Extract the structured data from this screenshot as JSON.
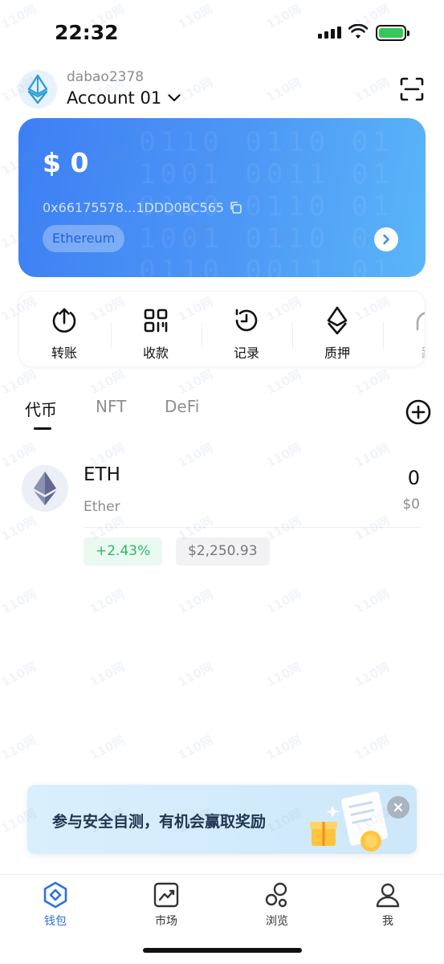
{
  "status_bar": {
    "time": "22:32"
  },
  "account": {
    "username": "dabao2378",
    "name": "Account 01"
  },
  "wallet_card": {
    "balance": "$ 0",
    "address": "0x66175578...1DDD0BC565",
    "network": "Ethereum"
  },
  "actions": [
    {
      "label": "转账",
      "icon": "transfer-icon"
    },
    {
      "label": "收款",
      "icon": "qr-code-icon"
    },
    {
      "label": "记录",
      "icon": "history-icon"
    },
    {
      "label": "质押",
      "icon": "ethereum-icon"
    },
    {
      "label": "跨",
      "icon": "bridge-icon"
    }
  ],
  "tabs": [
    {
      "label": "代币",
      "active": true
    },
    {
      "label": "NFT",
      "active": false
    },
    {
      "label": "DeFi",
      "active": false
    }
  ],
  "tokens": [
    {
      "symbol": "ETH",
      "name": "Ether",
      "amount": "0",
      "value": "$0",
      "change": "+2.43%",
      "price": "$2,250.93"
    }
  ],
  "promo": {
    "text": "参与安全自测，有机会赢取奖励"
  },
  "bottom_nav": [
    {
      "label": "钱包",
      "icon": "wallet-icon",
      "active": true
    },
    {
      "label": "市场",
      "icon": "market-chart-icon",
      "active": false
    },
    {
      "label": "浏览",
      "icon": "browse-icon",
      "active": false
    },
    {
      "label": "我",
      "icon": "profile-icon",
      "active": false
    }
  ],
  "watermark": "110网",
  "colors": {
    "accent": "#2f6fe0",
    "positive": "#2fb56a",
    "card_start": "#3d7ff3",
    "card_end": "#5ab6f8"
  }
}
